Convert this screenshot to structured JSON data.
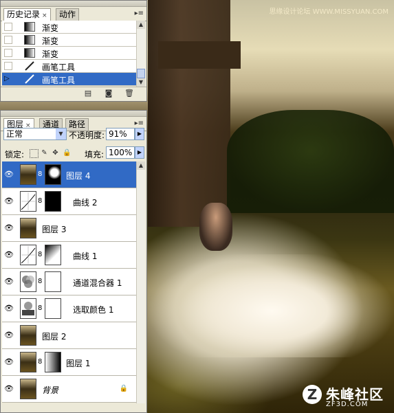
{
  "watermark_top": "思缘设计论坛 WWW.MISSYUAN.COM",
  "brand": {
    "logo": "Z",
    "name": "朱峰社区",
    "url": "ZF3D.COM"
  },
  "history_panel": {
    "tabs": [
      {
        "label": "历史记录",
        "close": "×"
      },
      {
        "label": "动作"
      }
    ],
    "menu": "▸≡",
    "items": [
      {
        "label": "渐变",
        "icon": "gradient-icon"
      },
      {
        "label": "渐变",
        "icon": "gradient-icon"
      },
      {
        "label": "渐变",
        "icon": "gradient-icon"
      },
      {
        "label": "画笔工具",
        "icon": "brush-icon"
      },
      {
        "label": "画笔工具",
        "icon": "brush-icon",
        "selected": true
      }
    ],
    "footer_icons": [
      "new-document-icon",
      "camera-icon",
      "trash-icon"
    ]
  },
  "layers_panel": {
    "tabs": [
      {
        "label": "图层",
        "close": "×"
      },
      {
        "label": "通道"
      },
      {
        "label": "路径"
      }
    ],
    "menu": "▸≡",
    "blend_mode": "正常",
    "opacity_label": "不透明度:",
    "opacity_value": "91%",
    "lock_label": "锁定:",
    "fill_label": "填充:",
    "fill_value": "100%",
    "layers": [
      {
        "name": "图层 4",
        "thumb": "photo",
        "mask": "hole",
        "selected": true
      },
      {
        "name": "曲线 2",
        "thumb": "curve",
        "mask": "black"
      },
      {
        "name": "图层 3",
        "thumb": "photo"
      },
      {
        "name": "曲线 1",
        "thumb": "curve",
        "mask": "fade"
      },
      {
        "name": "通道混合器 1",
        "thumb": "mixer",
        "mask": "white"
      },
      {
        "name": "选取颜色 1",
        "thumb": "mixer",
        "mask": "white"
      },
      {
        "name": "图层 2",
        "thumb": "photo"
      },
      {
        "name": "图层 1",
        "thumb": "photo",
        "mask": "grad"
      },
      {
        "name": "背景",
        "thumb": "photo",
        "locked": true,
        "background": true
      }
    ]
  },
  "colors": {
    "selection": "#316ac5",
    "panel_bg": "#ece9d8"
  }
}
